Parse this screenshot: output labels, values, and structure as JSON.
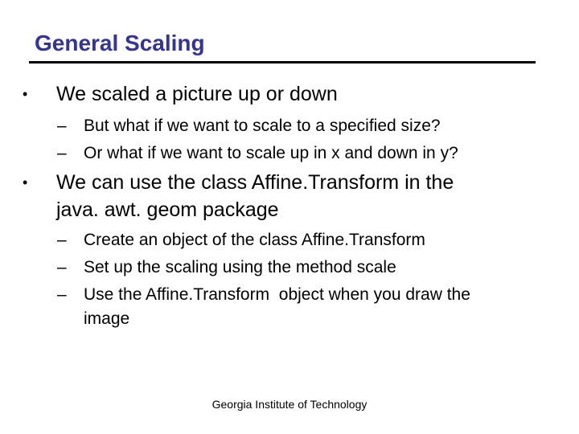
{
  "slide": {
    "title": "General Scaling",
    "title_color": "#333399",
    "bullets": [
      {
        "text": "We scaled a picture up or down",
        "sub": [
          "But what if we want to scale to a specified size?",
          "Or what if we want to scale up in x and down in y?"
        ]
      },
      {
        "text_lines": [
          "We can use the class Affine.Transform in the",
          "java. awt. geom package"
        ],
        "sub": [
          "Create an object of the class Affine.Transform",
          "Set up the scaling using the method scale",
          "Use the Affine.Transform  object when you draw the",
          "image"
        ]
      }
    ],
    "bullet_glyph": "•",
    "dash_glyph": "–",
    "footer": "Georgia Institute of Technology"
  }
}
